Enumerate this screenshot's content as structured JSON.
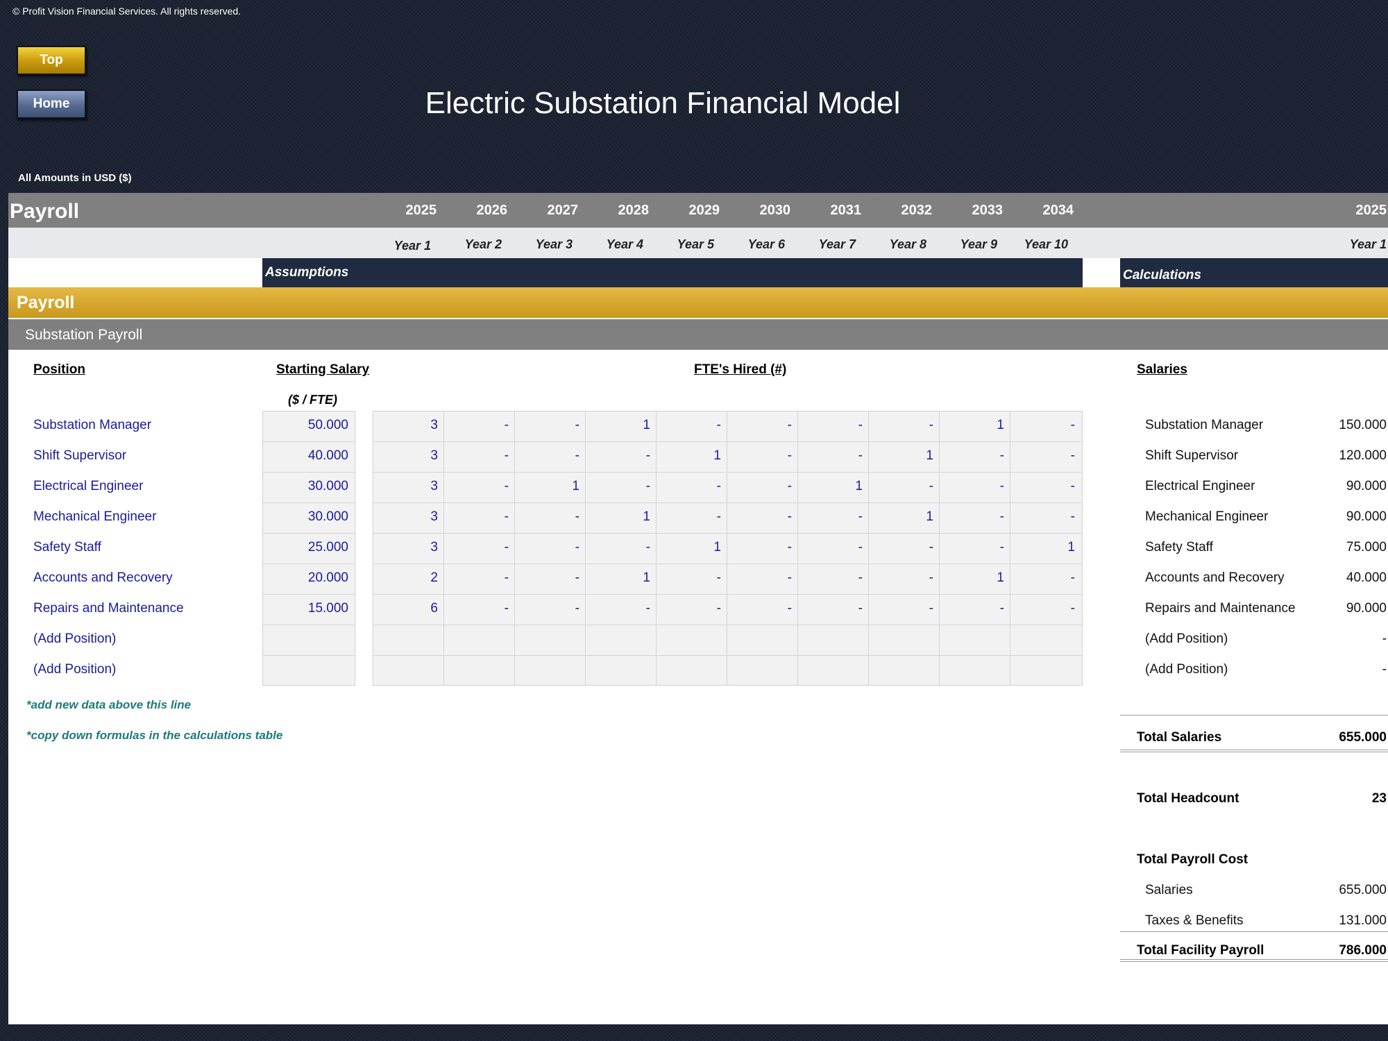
{
  "copyright": "© Profit Vision Financial Services. All rights reserved.",
  "nav": {
    "top_label": "Top",
    "home_label": "Home"
  },
  "title": "Electric Substation Financial Model",
  "currency": "All Amounts in  USD ($)",
  "header": {
    "section": "Payroll",
    "years": [
      "2025",
      "2026",
      "2027",
      "2028",
      "2029",
      "2030",
      "2031",
      "2032",
      "2033",
      "2034"
    ],
    "year_labels": [
      "Year 1",
      "Year 2",
      "Year 3",
      "Year 4",
      "Year 5",
      "Year 6",
      "Year 7",
      "Year 8",
      "Year 9",
      "Year 10"
    ],
    "calc_year": "2025",
    "calc_year_label": "Year 1",
    "assumptions": "Assumptions",
    "calculations": "Calculations"
  },
  "section_gold": "Payroll",
  "section_grey": "Substation Payroll",
  "columns": {
    "position": "Position",
    "starting_salary": "Starting Salary",
    "salary_unit": "($ / FTE)",
    "fte": "FTE's Hired (#)",
    "salaries": "Salaries"
  },
  "rows": [
    {
      "name": "Substation Manager",
      "salary": "50.000",
      "fte": [
        "3",
        "-",
        "-",
        "1",
        "-",
        "-",
        "-",
        "-",
        "1",
        "-"
      ],
      "calc": "150.000"
    },
    {
      "name": "Shift Supervisor",
      "salary": "40.000",
      "fte": [
        "3",
        "-",
        "-",
        "-",
        "1",
        "-",
        "-",
        "1",
        "-",
        "-"
      ],
      "calc": "120.000"
    },
    {
      "name": "Electrical Engineer",
      "salary": "30.000",
      "fte": [
        "3",
        "-",
        "1",
        "-",
        "-",
        "-",
        "1",
        "-",
        "-",
        "-"
      ],
      "calc": "90.000"
    },
    {
      "name": "Mechanical Engineer",
      "salary": "30.000",
      "fte": [
        "3",
        "-",
        "-",
        "1",
        "-",
        "-",
        "-",
        "1",
        "-",
        "-"
      ],
      "calc": "90.000"
    },
    {
      "name": "Safety Staff",
      "salary": "25.000",
      "fte": [
        "3",
        "-",
        "-",
        "-",
        "1",
        "-",
        "-",
        "-",
        "-",
        "1"
      ],
      "calc": "75.000"
    },
    {
      "name": "Accounts and Recovery",
      "salary": "20.000",
      "fte": [
        "2",
        "-",
        "-",
        "1",
        "-",
        "-",
        "-",
        "-",
        "1",
        "-"
      ],
      "calc": "40.000"
    },
    {
      "name": "Repairs and Maintenance",
      "salary": "15.000",
      "fte": [
        "6",
        "-",
        "-",
        "-",
        "-",
        "-",
        "-",
        "-",
        "-",
        "-"
      ],
      "calc": "90.000"
    },
    {
      "name": "(Add Position)",
      "salary": "",
      "fte": [
        "",
        "",
        "",
        "",
        "",
        "",
        "",
        "",
        "",
        ""
      ],
      "calc": "-"
    },
    {
      "name": "(Add Position)",
      "salary": "",
      "fte": [
        "",
        "",
        "",
        "",
        "",
        "",
        "",
        "",
        "",
        ""
      ],
      "calc": "-"
    }
  ],
  "notes": [
    "*add new data above this line",
    "*copy down formulas in the calculations table"
  ],
  "totals": {
    "total_salaries_label": "Total Salaries",
    "total_salaries": "655.000",
    "total_headcount_label": "Total Headcount",
    "total_headcount": "23",
    "total_payroll_cost_label": "Total Payroll Cost",
    "salaries_label": "Salaries",
    "salaries": "655.000",
    "taxes_label": "Taxes & Benefits",
    "taxes": "131.000",
    "facility_label": "Total Facility Payroll",
    "facility": "786.000"
  }
}
